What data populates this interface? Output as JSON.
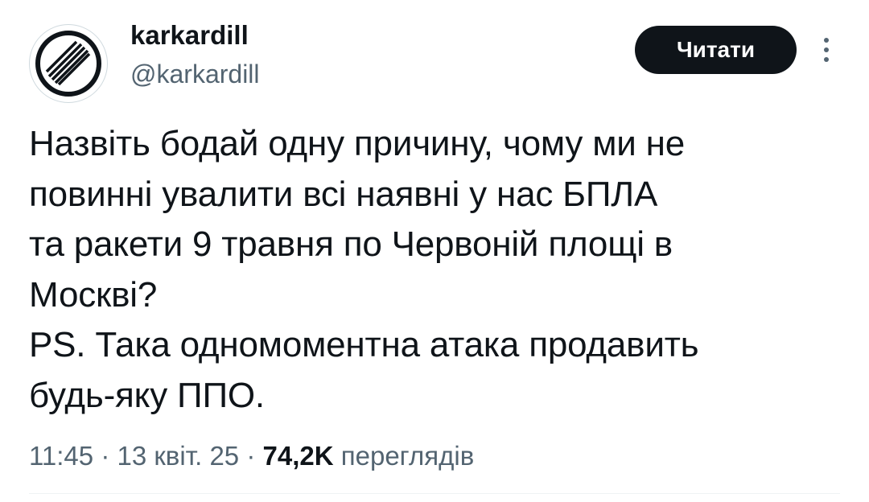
{
  "author": {
    "display_name": "karkardill",
    "handle": "@karkardill",
    "avatar_icon": "no-entry-end-sign-icon"
  },
  "actions": {
    "follow_label": "Читати",
    "more_icon": "more-vertical-icon"
  },
  "tweet": {
    "lines": [
      "Назвіть бодай одну причину, чому ми не",
      "повинні увалити всі наявні у нас БПЛА",
      "та ракети 9 травня по Червоній площі в",
      "Москві?",
      "PS. Така одномоментна атака продавить",
      "будь-яку ППО."
    ]
  },
  "meta": {
    "time": "11:45",
    "separator": "·",
    "date": "13 квіт. 25",
    "views_count": "74,2K",
    "views_label": "переглядів"
  },
  "colors": {
    "text": "#0f1419",
    "secondary": "#536471",
    "button_bg": "#0f1419",
    "button_text": "#ffffff"
  }
}
